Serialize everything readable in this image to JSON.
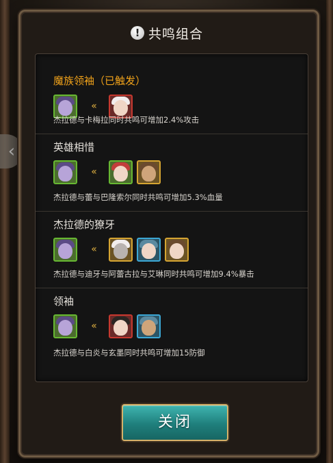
{
  "dialog": {
    "title": "共鸣组合",
    "title_icon": "!",
    "close_label": "关闭"
  },
  "combos": [
    {
      "name": "魔族领袖（已触发）",
      "active": true,
      "desc": "杰拉德与卡梅拉同时共鸣可增加2.4%攻击"
    },
    {
      "name": "英雄相惜",
      "active": false,
      "desc": "杰拉德与蕾与巴隆索尔同时共鸣可增加5.3%血量"
    },
    {
      "name": "杰拉德的獠牙",
      "active": false,
      "desc": "杰拉德与迪牙与阿蕾古拉与艾琳同时共鸣可增加9.4%暴击"
    },
    {
      "name": "领袖",
      "active": false,
      "desc": "杰拉德与白炎与玄墨同时共鸣可增加15防御"
    }
  ],
  "icons": {
    "arrow": "«"
  },
  "colors": {
    "active_name": "#f0a21a",
    "frame_green": "#67b832",
    "frame_red": "#c6382f",
    "frame_gold": "#d6a532",
    "frame_blue": "#3ca8d6",
    "close_button": "#1f7f7c"
  }
}
